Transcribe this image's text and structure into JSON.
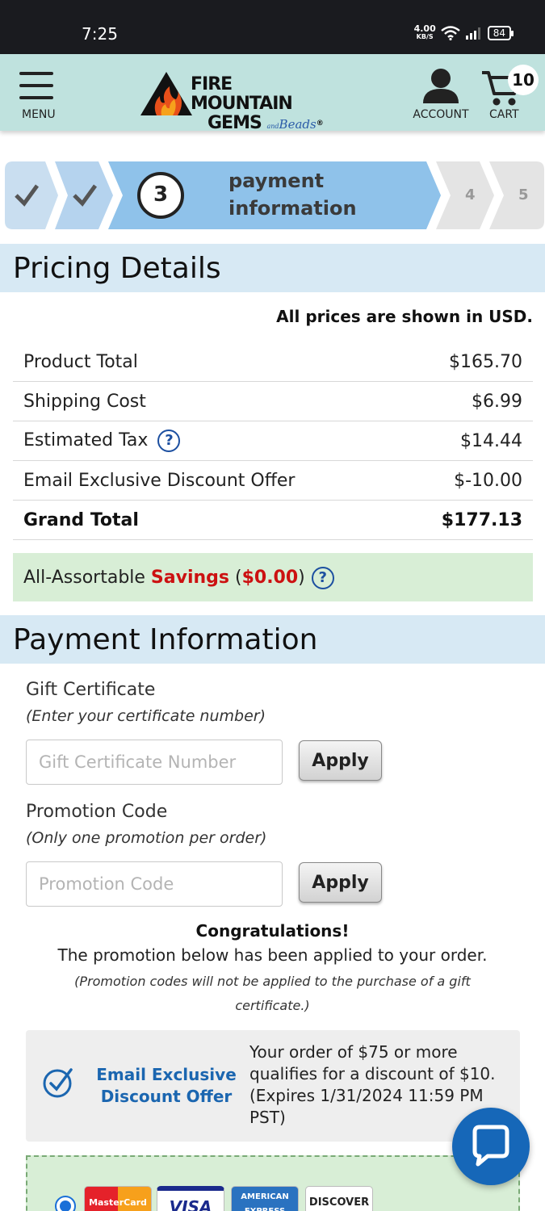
{
  "status_bar": {
    "time": "7:25",
    "net_speed_value": "4.00",
    "net_speed_unit": "KB/S",
    "battery": "84"
  },
  "header": {
    "menu_label": "MENU",
    "logo_line1": "FIRE MOUNTAIN",
    "logo_line2": "GEMS",
    "logo_small": "and",
    "logo_beads": "Beads",
    "logo_reg": "®",
    "account_label": "ACCOUNT",
    "cart_label": "CART",
    "cart_count": "10"
  },
  "checkout_steps": {
    "current_number": "3",
    "current_label_line1": "payment",
    "current_label_line2": "information",
    "step4": "4",
    "step5": "5"
  },
  "pricing": {
    "heading": "Pricing Details",
    "currency_note": "All prices are shown in USD.",
    "rows": [
      {
        "label": "Product Total",
        "value": "$165.70"
      },
      {
        "label": "Shipping Cost",
        "value": "$6.99"
      },
      {
        "label": "Estimated Tax",
        "value": "$14.44"
      },
      {
        "label": "Email Exclusive Discount Offer",
        "value": "$-10.00"
      },
      {
        "label": "Grand Total",
        "value": "$177.13"
      }
    ],
    "help_glyph": "?",
    "savings_prefix": "All-Assortable ",
    "savings_word": "Savings",
    "savings_open": " (",
    "savings_amount": "$0.00",
    "savings_close": ")"
  },
  "payment": {
    "heading": "Payment Information",
    "gift_label": "Gift Certificate",
    "gift_hint": "(Enter your certificate number)",
    "gift_placeholder": "Gift Certificate Number",
    "gift_apply": "Apply",
    "promo_label": "Promotion Code",
    "promo_hint": "(Only one promotion per order)",
    "promo_placeholder": "Promotion Code",
    "promo_apply": "Apply",
    "congrats_title": "Congratulations!",
    "congrats_msg": "The promotion below has been applied to your order.",
    "congrats_note": "(Promotion codes will not be applied to the purchase of a gift certificate.)",
    "applied_promo_name": "Email Exclusive Discount Offer",
    "applied_promo_desc": "Your order of $75 or more qualifies for a discount of $10. (Expires 1/31/2024 11:59 PM PST)",
    "cards": [
      "MasterCard",
      "VISA",
      "AMERICAN EXPRESS",
      "DISCOVER"
    ]
  },
  "colors": {
    "header_bg": "#bfe2de",
    "section_bg": "#d7e9f4",
    "savings_bg": "#d8eed6",
    "link_blue": "#1b66b0",
    "savings_red": "#cc1111"
  }
}
